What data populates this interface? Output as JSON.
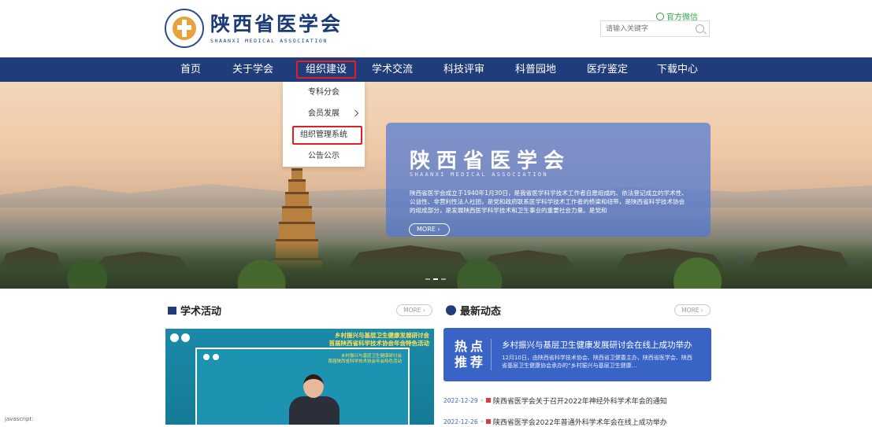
{
  "header": {
    "logo_cn": "陕西省医学会",
    "logo_en": "SHAANXI MEDICAL ASSOCIATION",
    "wechat_label": "官方微信",
    "search_placeholder": "请输入关键字"
  },
  "nav": {
    "items": [
      "首页",
      "关于学会",
      "组织建设",
      "学术交流",
      "科技评审",
      "科普园地",
      "医疗鉴定",
      "下载中心"
    ],
    "active_index": 2
  },
  "dropdown": {
    "items": [
      "专科分会",
      "会员发展",
      "组织管理系统",
      "公告公示"
    ]
  },
  "banner": {
    "title": "陕西省医学会",
    "subtitle": "SHAANXI MEDICAL ASSOCIATION",
    "text": "陕西省医学会成立于1940年1月30日，是我省医学科学技术工作者自愿组成的、依法登记成立的学术性、公益性、非营利性法人社团，是党和政府联系医学科学技术工作者的桥梁和纽带，是陕西省科学技术协会的组成部分，是发展陕西医学科学技术和卫生事业的重要社会力量。是党和",
    "more": "MORE"
  },
  "academic": {
    "title": "学术活动",
    "more": "MORE",
    "video_title_line1": "乡村振兴与基层卫生健康发展研讨会",
    "video_title_line2": "首届陕西省科学技术协会年会特色活动",
    "video_inner_line1": "乡村振兴与基层卫生健康研讨会",
    "video_inner_line2": "首届陕西省科学技术协会年会特色活动"
  },
  "latest": {
    "title": "最新动态",
    "more": "MORE",
    "hot_label": "热点推荐",
    "hot_title": "乡村振兴与基层卫生健康发展研讨会在线上成功举办",
    "hot_desc": "12月10日，由陕西省科学技术协会、陕西省卫健委主办，陕西省医学会、陕西省基层卫生健康协会承办的“乡村振兴与基层卫生健康...",
    "news": [
      {
        "date": "2022-12-29",
        "title": "陕西省医学会关于召开2022年神经外科学术年会的通知"
      },
      {
        "date": "2022-12-26",
        "title": "陕西省医学会2022年普通外科学术年会在线上成功举办"
      }
    ]
  },
  "status_bar": "javascript:",
  "colors": {
    "nav_bg": "#213c7a",
    "highlight": "#e02020",
    "accent_blue": "#3a63c6",
    "wechat_green": "#2fa34a"
  }
}
